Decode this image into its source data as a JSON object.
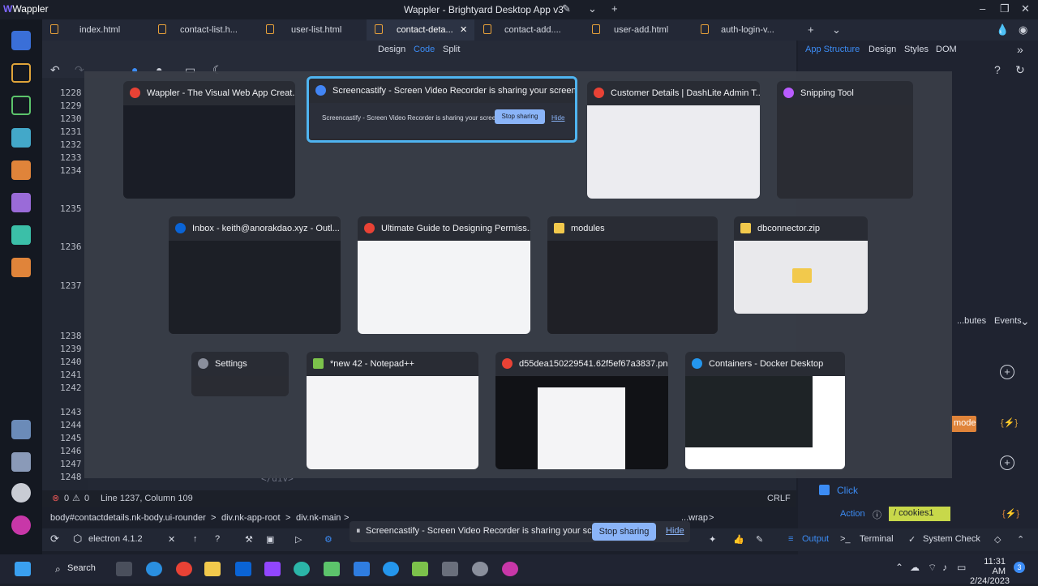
{
  "titlebar": {
    "app_logo": "Wappler",
    "title": "Wappler - Brightyard Desktop App v3"
  },
  "tabs": [
    {
      "label": "index.html"
    },
    {
      "label": "contact-list.h..."
    },
    {
      "label": "user-list.html"
    },
    {
      "label": "contact-deta...",
      "active": true
    },
    {
      "label": "contact-add...."
    },
    {
      "label": "user-add.html"
    },
    {
      "label": "auth-login-v..."
    }
  ],
  "editor": {
    "modes": {
      "design": "Design",
      "code": "Code",
      "split": "Split"
    },
    "line_numbers": [
      {
        "n": "1228"
      },
      {
        "n": "1229"
      },
      {
        "n": "1230"
      },
      {
        "n": "1231"
      },
      {
        "n": "1232"
      },
      {
        "n": "1233"
      },
      {
        "n": "1234"
      },
      {
        "n": "1235"
      },
      {
        "n": "1236"
      },
      {
        "n": "1237"
      },
      {
        "n": "1238"
      },
      {
        "n": "1239"
      },
      {
        "n": "1240"
      },
      {
        "n": "1241"
      },
      {
        "n": "1242"
      },
      {
        "n": "1243"
      },
      {
        "n": "1244"
      },
      {
        "n": "1245"
      },
      {
        "n": "1246"
      },
      {
        "n": "1247"
      },
      {
        "n": "1248"
      }
    ],
    "code_fragment": "</div>"
  },
  "rightpanel": {
    "tabs": {
      "app_structure": "App Structure",
      "design": "Design",
      "styles": "Styles",
      "dom": "DOM"
    },
    "subtabs": {
      "attributes": "...butes",
      "events": "Events"
    },
    "mode_tag": "mode",
    "click_label": "Click",
    "action_label": "Action",
    "action_value": "/ cookies1"
  },
  "statusbar": {
    "errors": "0",
    "warnings": "0",
    "position": "Line 1237, Column 109",
    "eol": "CRLF"
  },
  "breadcrumb": {
    "items": [
      "body#contactdetails.nk-body.ui-rounder",
      "div.nk-app-root",
      "div.nk-main",
      "...wrap"
    ]
  },
  "bottombar": {
    "electron": "electron 4.1.2",
    "output": "Output",
    "terminal": "Terminal",
    "system_check": "System Check"
  },
  "sharebar": {
    "message": "Screencastify - Screen Video Recorder is sharing your screen.",
    "stop": "Stop sharing",
    "hide": "Hide"
  },
  "taskview": {
    "windows": [
      {
        "title": "Wappler - The Visual Web App Creat...",
        "icon_color": "#e94235"
      },
      {
        "title": "Screencastify - Screen Video Recorder is sharing your screen.",
        "icon_color": "#4285f4",
        "selected": true
      },
      {
        "title": "Customer Details | DashLite Admin T...",
        "icon_color": "#e94235"
      },
      {
        "title": "Snipping Tool",
        "icon_color": "#b95cff"
      },
      {
        "title": "Inbox - keith@anorakdao.xyz - Outl...",
        "icon_color": "#0a64d6"
      },
      {
        "title": "Ultimate Guide to Designing Permiss...",
        "icon_color": "#e94235"
      },
      {
        "title": "modules",
        "icon_color": "#f2c94c"
      },
      {
        "title": "dbconnector.zip",
        "icon_color": "#f2c94c"
      },
      {
        "title": "Settings",
        "icon_color": "#8a8f9c"
      },
      {
        "title": "*new 42 - Notepad++",
        "icon_color": "#7cc24b"
      },
      {
        "title": "d55dea150229541.62f5ef67a3837.pn...",
        "icon_color": "#e94235"
      },
      {
        "title": "Containers - Docker Desktop",
        "icon_color": "#2496ed"
      }
    ],
    "share_preview": {
      "message": "Screencastify - Screen Video Recorder is sharing your screen.",
      "stop": "Stop sharing",
      "hide": "Hide"
    }
  },
  "taskbar": {
    "search": "Search",
    "time": "11:31 AM",
    "date": "2/24/2023",
    "notifications": "3"
  }
}
